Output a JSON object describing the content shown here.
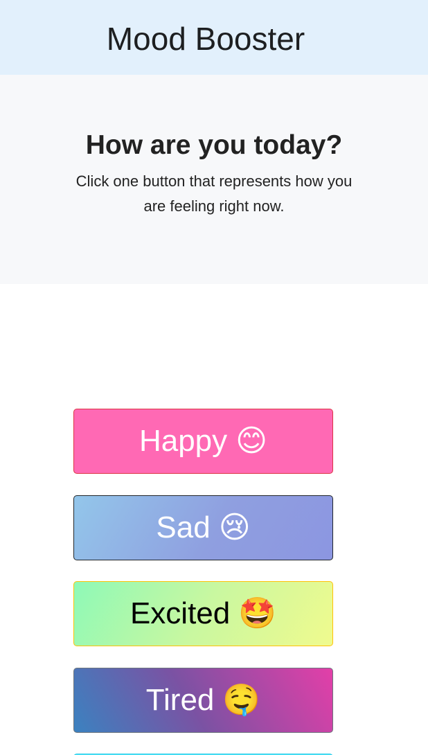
{
  "header": {
    "title": "Mood Booster"
  },
  "hero": {
    "heading": "How are you today?",
    "text": "Click one button that represents how you are feeling right now."
  },
  "moods": [
    {
      "label": "Happy",
      "emoji": "😊"
    },
    {
      "label": "Sad",
      "emoji": "😢"
    },
    {
      "label": "Excited",
      "emoji": "🤩"
    },
    {
      "label": "Tired",
      "emoji": "🤤"
    }
  ],
  "colors": {
    "header_bg": "#e2f0fc",
    "hero_bg": "#f7f8fa",
    "happy_bg": "#ff69b4",
    "happy_border": "#dc3545",
    "sad_border": "#212529",
    "excited_border": "#ffc107",
    "tired_border": "#6c757d",
    "partial_button": "#5ee6f7"
  }
}
